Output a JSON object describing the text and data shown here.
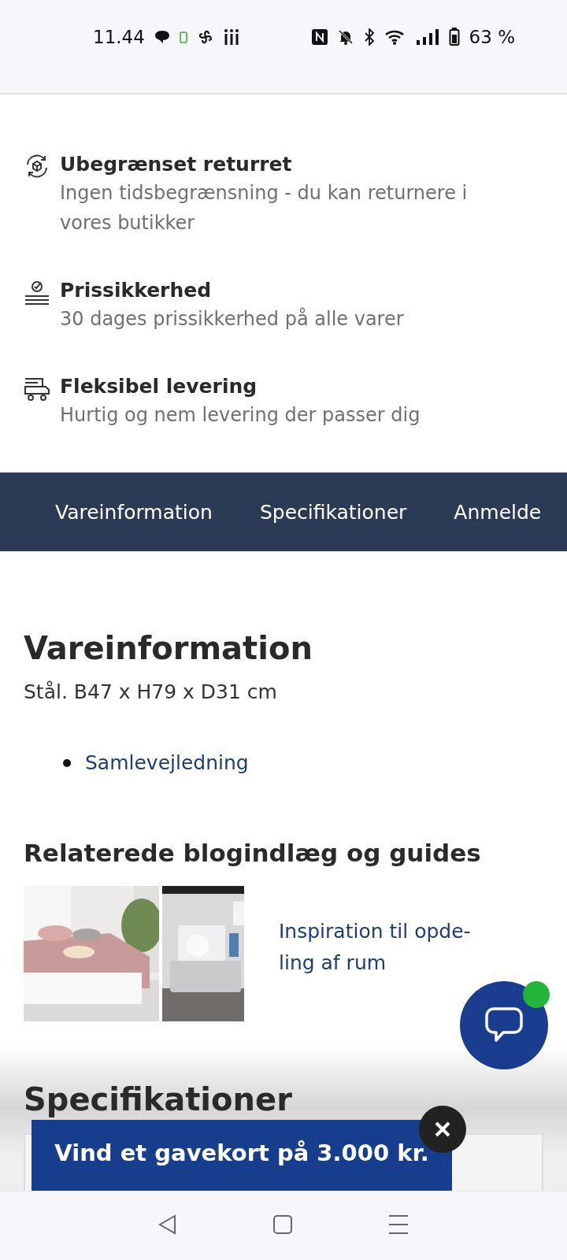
{
  "status_bar": {
    "time": "11.44",
    "battery": "63 %"
  },
  "features": [
    {
      "kind": "return",
      "title": "Ubegrænset returret",
      "text": "Ingen tidsbegrænsning - du kan returnere i vores butikker"
    },
    {
      "kind": "price",
      "title": "Prissikkerhed",
      "text": "30 dages prissikkerhed på alle varer"
    },
    {
      "kind": "delivery",
      "title": "Fleksibel levering",
      "text": "Hurtig og nem levering der passer dig"
    }
  ],
  "section_tabs": [
    "Vareinformation",
    "Specifikationer",
    "Anmelde"
  ],
  "product_info": {
    "heading": "Vareinformation",
    "description": "Stål. B47 x H79 x D31 cm",
    "links": [
      "Samlevejledning"
    ]
  },
  "related": {
    "heading": "Relaterede blogindlæg og guides",
    "articles": [
      {
        "title": "Inspiration til opde-ling af rum"
      }
    ]
  },
  "specifications": {
    "heading": "Specifikationer"
  },
  "chat": {
    "notification": true
  },
  "promo": {
    "text": "Vind et gavekort på 3.000 kr."
  }
}
